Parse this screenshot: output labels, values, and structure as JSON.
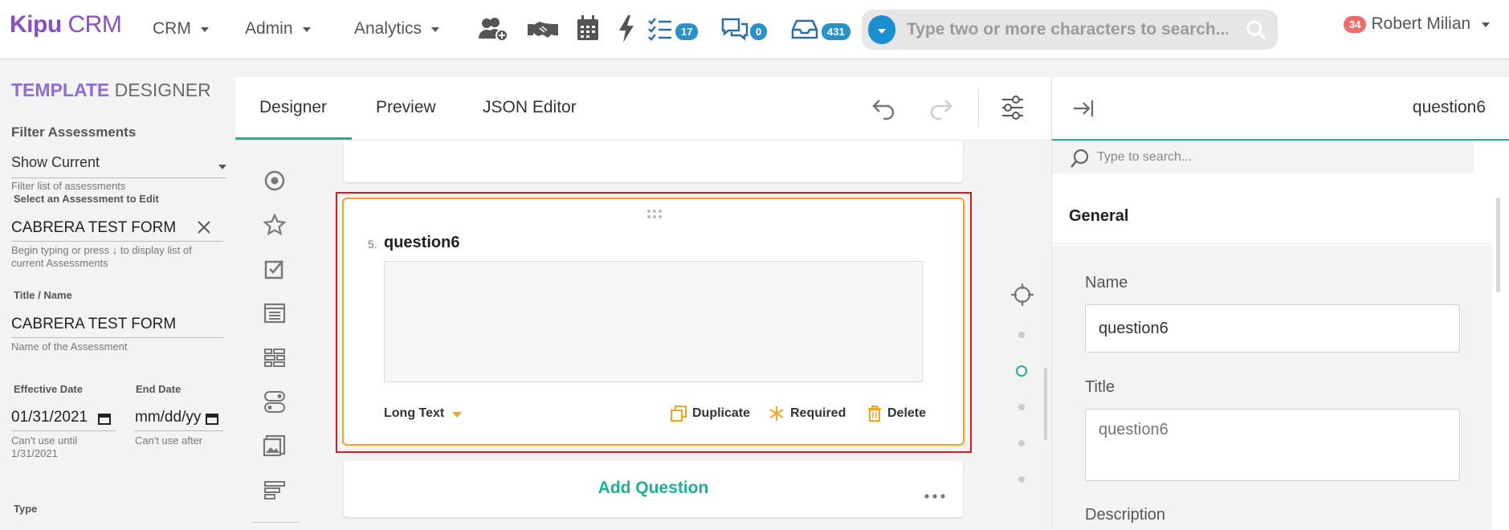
{
  "colors": {
    "brand": "#8a4fc8",
    "accent": "#19b394",
    "badge_blue": "#2b91c9",
    "badge_red": "#ef6b6b",
    "selection_orange": "#f6a41c",
    "highlight_red": "#e4161d"
  },
  "topnav": {
    "logo_bold": "Kipu",
    "logo_light": " CRM",
    "menus": [
      "CRM",
      "Admin",
      "Analytics"
    ],
    "icons": [
      "add-user-icon",
      "handshake-icon",
      "calendar-icon",
      "lightning-icon",
      "checklist-icon",
      "chat-icon",
      "inbox-icon"
    ],
    "badges": {
      "tasks": "17",
      "chat": "0",
      "inbox": "431"
    },
    "search_placeholder": "Type two or more characters to search...",
    "user": {
      "badge": "34",
      "name": "Robert Milian"
    }
  },
  "left_panel": {
    "title_bold": "TEMPLATE",
    "title_light": " DESIGNER",
    "filter_label": "Filter Assessments",
    "filter_value": "Show Current",
    "filter_help": "Filter list of assessments",
    "select_label": "Select an Assessment to Edit",
    "select_value": "CABRERA TEST FORM",
    "select_help": "Begin typing or press ↓ to display list of current Assessments",
    "title_label": "Title / Name",
    "title_value": "CABRERA TEST FORM",
    "title_help": "Name of the Assessment",
    "effective_label": "Effective Date",
    "effective_value": "01/31/2021",
    "effective_help": "Can't use until 1/31/2021",
    "end_label": "End Date",
    "end_value": "mm/dd/yy",
    "end_help": "Can't use after",
    "type_label": "Type"
  },
  "designer": {
    "tabs": [
      "Designer",
      "Preview",
      "JSON Editor"
    ],
    "active_tab": "Designer",
    "toolbox_icons": [
      "radio-icon",
      "rating-star-icon",
      "checkbox-icon",
      "comment-icon",
      "matrix-icon",
      "boolean-icon",
      "image-icon",
      "panel-icon"
    ],
    "question": {
      "number": "5.",
      "title": "question6",
      "type": "Long Text",
      "actions": [
        "Duplicate",
        "Required",
        "Delete"
      ]
    },
    "add_question": "Add Question"
  },
  "right_panel": {
    "header_title": "question6",
    "search_placeholder": "Type to search...",
    "section": "General",
    "name_label": "Name",
    "name_value": "question6",
    "title_label": "Title",
    "title_placeholder": "question6",
    "description_label": "Description"
  }
}
